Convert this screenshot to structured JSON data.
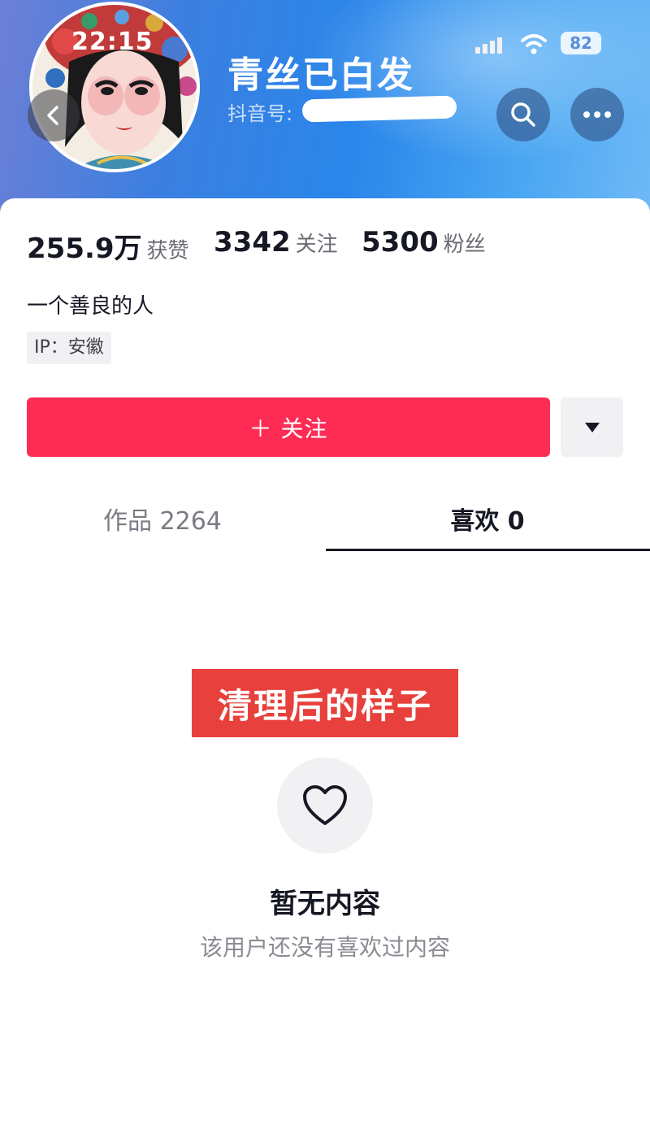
{
  "status_bar": {
    "time": "22:15",
    "battery": "82"
  },
  "profile": {
    "username": "青丝已白发",
    "douyin_id_label": "抖音号:",
    "stats": [
      {
        "value": "255.9万",
        "label": "获赞"
      },
      {
        "value": "3342",
        "label": "关注"
      },
      {
        "value": "5300",
        "label": "粉丝"
      }
    ],
    "bio": "一个善良的人",
    "ip_location": "IP：安徽"
  },
  "actions": {
    "follow_label": "＋ 关注"
  },
  "tabs": [
    {
      "label": "作品 2264",
      "active": false
    },
    {
      "label": "喜欢 0",
      "active": true
    }
  ],
  "overlay_banner": "清理后的样子",
  "empty_state": {
    "title": "暂无内容",
    "subtitle": "该用户还没有喜欢过内容"
  },
  "colors": {
    "follow_button": "#fe2c55",
    "overlay_banner": "#e8403c",
    "header_gradient": "#2a86ea"
  },
  "icons": [
    "back-arrow-icon",
    "search-icon",
    "more-icon",
    "dropdown-triangle-icon",
    "heart-icon",
    "signal-icon",
    "wifi-icon",
    "battery-icon"
  ]
}
